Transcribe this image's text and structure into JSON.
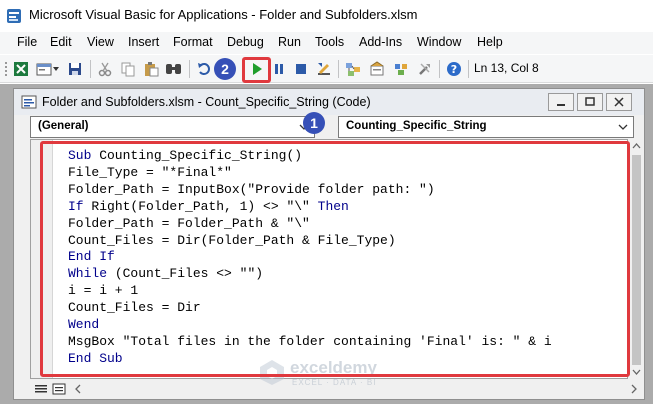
{
  "app": {
    "title": "Microsoft Visual Basic for Applications - Folder and Subfolders.xlsm"
  },
  "menu": {
    "items": [
      "File",
      "Edit",
      "View",
      "Insert",
      "Format",
      "Debug",
      "Run",
      "Tools",
      "Add-Ins",
      "Window",
      "Help"
    ]
  },
  "toolbar": {
    "status": "Ln 13, Col 8",
    "icons": [
      "excel-icon",
      "insert-userform-icon",
      "save-icon",
      "cut-icon",
      "copy-icon",
      "paste-icon",
      "find-icon",
      "undo-icon",
      "run-icon",
      "break-icon",
      "reset-icon",
      "design-mode-icon",
      "project-explorer-icon",
      "properties-icon",
      "object-browser-icon",
      "toolbox-icon",
      "help-icon"
    ]
  },
  "code_window": {
    "title": "Folder and Subfolders.xlsm - Count_Specific_String (Code)",
    "object_combo": "(General)",
    "procedure_combo": "Counting_Specific_String"
  },
  "code": {
    "lines": [
      "Sub Counting_Specific_String()",
      "File_Type = \"*Final*\"",
      "Folder_Path = InputBox(\"Provide folder path: \")",
      "If Right(Folder_Path, 1) <> \"\\\" Then",
      "Folder_Path = Folder_Path & \"\\\"",
      "Count_Files = Dir(Folder_Path & File_Type)",
      "End If",
      "While (Count_Files <> \"\")",
      "i = i + 1",
      "Count_Files = Dir",
      "Wend",
      "MsgBox \"Total files in the folder containing 'Final' is: \" & i",
      "End Sub"
    ],
    "keywords": [
      "Sub",
      "End Sub",
      "If",
      "Then",
      "End If",
      "While",
      "Wend"
    ]
  },
  "annotations": {
    "badge_1": "1",
    "badge_2": "2",
    "highlight_color": "#e0393e",
    "badge_color": "#3650b7"
  },
  "watermark": {
    "name": "exceldemy",
    "tagline": "EXCEL · DATA · BI"
  },
  "colors": {
    "keyword": "#00008b",
    "mdi_background": "#ababab",
    "run_green": "#1f9e2c"
  }
}
